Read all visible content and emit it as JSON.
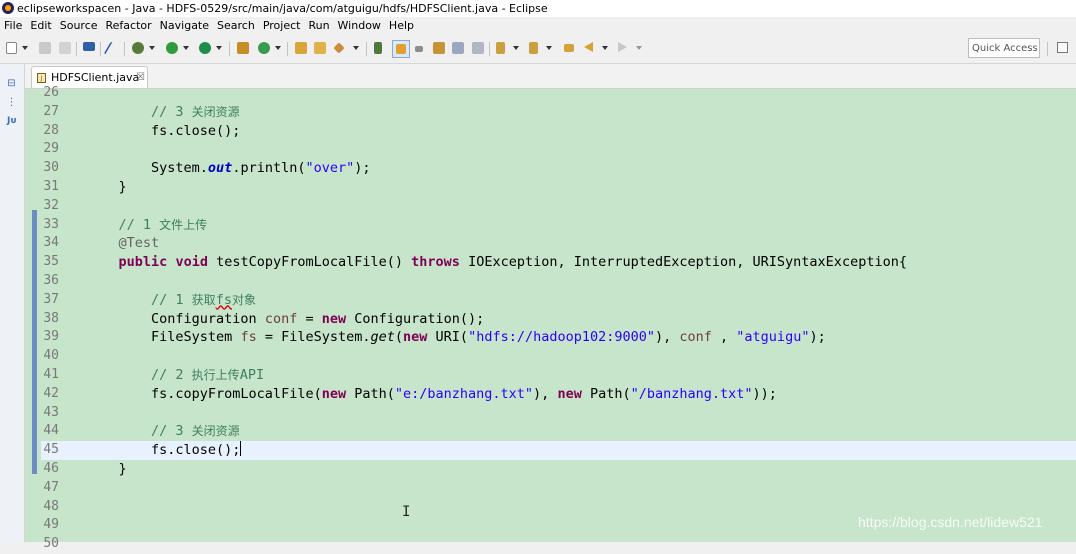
{
  "window": {
    "title": "eclipseworkspacen - Java - HDFS-0529/src/main/java/com/atguigu/hdfs/HDFSClient.java - Eclipse"
  },
  "menu": [
    "File",
    "Edit",
    "Source",
    "Refactor",
    "Navigate",
    "Search",
    "Project",
    "Run",
    "Window",
    "Help"
  ],
  "toolbar": {
    "quick_access": "Quick Access"
  },
  "tab": {
    "label": "HDFSClient.java",
    "close": "☒"
  },
  "left_panel": {
    "icons": [
      "⊟",
      "⋮",
      "Jᴜ"
    ]
  },
  "editor": {
    "partial_top_line": "26",
    "lines": [
      {
        "n": "27",
        "segments": [
          {
            "t": "        // 3 ",
            "c": "cm"
          },
          {
            "t": "关闭资源",
            "c": "cm cm-cn"
          }
        ]
      },
      {
        "n": "28",
        "segments": [
          {
            "t": "        fs.close();",
            "c": ""
          }
        ]
      },
      {
        "n": "29",
        "segments": []
      },
      {
        "n": "30",
        "segments": [
          {
            "t": "        System.",
            "c": ""
          },
          {
            "t": "out",
            "c": "fld"
          },
          {
            "t": ".println(",
            "c": ""
          },
          {
            "t": "\"over\"",
            "c": "st"
          },
          {
            "t": ");",
            "c": ""
          }
        ]
      },
      {
        "n": "31",
        "segments": [
          {
            "t": "    }",
            "c": ""
          }
        ]
      },
      {
        "n": "32",
        "segments": []
      },
      {
        "n": "33",
        "segments": [
          {
            "t": "    // 1 ",
            "c": "cm"
          },
          {
            "t": "文件上传",
            "c": "cm cm-cn"
          }
        ]
      },
      {
        "n": "34",
        "segments": [
          {
            "t": "    @Test",
            "c": "ann"
          }
        ]
      },
      {
        "n": "35",
        "segments": [
          {
            "t": "    ",
            "c": ""
          },
          {
            "t": "public",
            "c": "kw"
          },
          {
            "t": " ",
            "c": ""
          },
          {
            "t": "void",
            "c": "kw"
          },
          {
            "t": " testCopyFromLocalFile() ",
            "c": ""
          },
          {
            "t": "throws",
            "c": "kw"
          },
          {
            "t": " IOException, InterruptedException, URISyntaxException{",
            "c": ""
          }
        ]
      },
      {
        "n": "36",
        "segments": []
      },
      {
        "n": "37",
        "segments": [
          {
            "t": "        // 1 ",
            "c": "cm"
          },
          {
            "t": "获取",
            "c": "cm cm-cn"
          },
          {
            "t": "fs",
            "c": "cm und"
          },
          {
            "t": "对象",
            "c": "cm cm-cn"
          }
        ]
      },
      {
        "n": "38",
        "segments": [
          {
            "t": "        Configuration ",
            "c": ""
          },
          {
            "t": "conf",
            "c": "var"
          },
          {
            "t": " = ",
            "c": ""
          },
          {
            "t": "new",
            "c": "kw"
          },
          {
            "t": " Configuration();",
            "c": ""
          }
        ]
      },
      {
        "n": "39",
        "segments": [
          {
            "t": "        FileSystem ",
            "c": ""
          },
          {
            "t": "fs",
            "c": "var"
          },
          {
            "t": " = FileSystem.",
            "c": ""
          },
          {
            "t": "get",
            "c": "mi"
          },
          {
            "t": "(",
            "c": ""
          },
          {
            "t": "new",
            "c": "kw"
          },
          {
            "t": " URI(",
            "c": ""
          },
          {
            "t": "\"hdfs://hadoop102:9000\"",
            "c": "st"
          },
          {
            "t": "), ",
            "c": ""
          },
          {
            "t": "conf",
            "c": "var"
          },
          {
            "t": " , ",
            "c": ""
          },
          {
            "t": "\"atguigu\"",
            "c": "st"
          },
          {
            "t": ");",
            "c": ""
          }
        ]
      },
      {
        "n": "40",
        "segments": []
      },
      {
        "n": "41",
        "segments": [
          {
            "t": "        // 2 ",
            "c": "cm"
          },
          {
            "t": "执行上传",
            "c": "cm cm-cn"
          },
          {
            "t": "API",
            "c": "cm"
          }
        ]
      },
      {
        "n": "42",
        "segments": [
          {
            "t": "        fs.copyFromLocalFile(",
            "c": ""
          },
          {
            "t": "new",
            "c": "kw"
          },
          {
            "t": " Path(",
            "c": ""
          },
          {
            "t": "\"e:/banzhang.txt\"",
            "c": "st"
          },
          {
            "t": "), ",
            "c": ""
          },
          {
            "t": "new",
            "c": "kw"
          },
          {
            "t": " Path(",
            "c": ""
          },
          {
            "t": "\"/banzhang.txt\"",
            "c": "st"
          },
          {
            "t": "));",
            "c": ""
          }
        ]
      },
      {
        "n": "43",
        "segments": []
      },
      {
        "n": "44",
        "segments": [
          {
            "t": "        // 3 ",
            "c": "cm"
          },
          {
            "t": "关闭资源",
            "c": "cm cm-cn"
          }
        ]
      },
      {
        "n": "45",
        "segments": [
          {
            "t": "        fs.close();",
            "c": ""
          }
        ],
        "current": true
      },
      {
        "n": "46",
        "segments": [
          {
            "t": "    }",
            "c": ""
          }
        ]
      },
      {
        "n": "47",
        "segments": []
      },
      {
        "n": "48",
        "segments": []
      },
      {
        "n": "49",
        "segments": []
      },
      {
        "n": "50",
        "segments": []
      }
    ]
  },
  "watermark": "https://blog.csdn.net/lidew521",
  "colors": {
    "editor_bg": "#c7e5cb",
    "current_line": "#e8f2fe",
    "keyword": "#7f0055",
    "comment": "#3f7f5f",
    "string": "#2a00ff"
  }
}
